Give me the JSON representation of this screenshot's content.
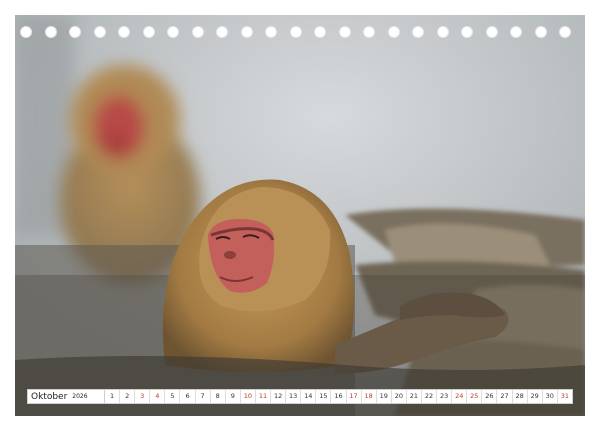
{
  "calendar": {
    "month": "Oktober",
    "year": "2026",
    "days": [
      {
        "label": "1",
        "weekend": false
      },
      {
        "label": "2",
        "weekend": false
      },
      {
        "label": "3",
        "weekend": true
      },
      {
        "label": "4",
        "weekend": true
      },
      {
        "label": "5",
        "weekend": false
      },
      {
        "label": "6",
        "weekend": false
      },
      {
        "label": "7",
        "weekend": false
      },
      {
        "label": "8",
        "weekend": false
      },
      {
        "label": "9",
        "weekend": false
      },
      {
        "label": "10",
        "weekend": true
      },
      {
        "label": "11",
        "weekend": true
      },
      {
        "label": "12",
        "weekend": false
      },
      {
        "label": "13",
        "weekend": false
      },
      {
        "label": "14",
        "weekend": false
      },
      {
        "label": "15",
        "weekend": false
      },
      {
        "label": "16",
        "weekend": false
      },
      {
        "label": "17",
        "weekend": true
      },
      {
        "label": "18",
        "weekend": true
      },
      {
        "label": "19",
        "weekend": false
      },
      {
        "label": "20",
        "weekend": false
      },
      {
        "label": "21",
        "weekend": false
      },
      {
        "label": "22",
        "weekend": false
      },
      {
        "label": "23",
        "weekend": false
      },
      {
        "label": "24",
        "weekend": true
      },
      {
        "label": "25",
        "weekend": true
      },
      {
        "label": "26",
        "weekend": false
      },
      {
        "label": "27",
        "weekend": false
      },
      {
        "label": "28",
        "weekend": false
      },
      {
        "label": "29",
        "weekend": false
      },
      {
        "label": "30",
        "weekend": false
      },
      {
        "label": "31",
        "weekend": true
      }
    ]
  },
  "colors": {
    "weekend_day": "#c0392b",
    "weekday": "#333333"
  }
}
